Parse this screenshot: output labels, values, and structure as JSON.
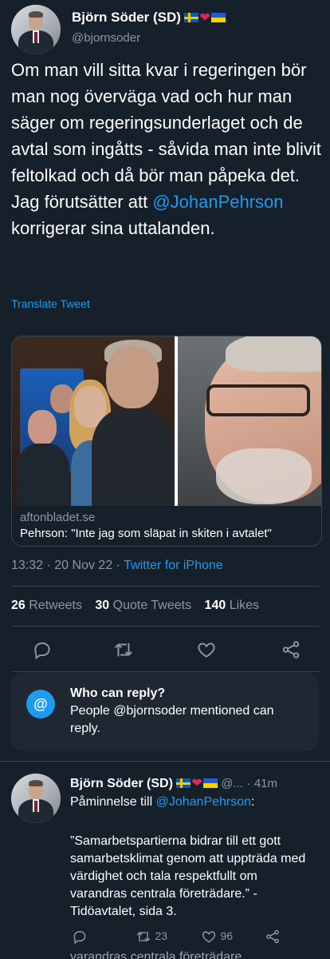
{
  "author": {
    "name": "Björn Söder (SD)",
    "handle": "@bjornsoder",
    "flag_se": "swedish-flag",
    "heart": "❤",
    "flag_ua": "ukrainian-flag"
  },
  "tweet": {
    "text_before": "Om man vill sitta kvar i regeringen bör man nog överväga vad och hur man säger om regeringsunderlaget och de avtal som ingåtts - såvida man inte blivit feltolkad och då bör man påpeka det. Jag förutsätter att ",
    "mention": "@JohanPehrson",
    "text_after": " korrigerar sina uttalanden.",
    "translate": "Translate Tweet"
  },
  "card": {
    "domain": "aftonbladet.se",
    "title": "Pehrson: \"Inte jag som släpat in skiten i avtalet\""
  },
  "meta": {
    "time": "13:32",
    "sep": "·",
    "date": "20 Nov 22",
    "source": "Twitter for iPhone"
  },
  "stats": {
    "retweets_count": "26",
    "retweets_label": "Retweets",
    "quotes_count": "30",
    "quotes_label": "Quote Tweets",
    "likes_count": "140",
    "likes_label": "Likes"
  },
  "actions": {
    "reply_icon": "reply-icon",
    "retweet_icon": "retweet-icon",
    "like_icon": "heart-icon",
    "share_icon": "share-icon"
  },
  "who_can_reply": {
    "icon": "@",
    "title": "Who can reply?",
    "body": "People @bjornsoder mentioned can reply."
  },
  "reply": {
    "name": "Björn Söder (SD)",
    "handle": "@...",
    "sep": "·",
    "time": "41m",
    "prefix": "Påminnelse till ",
    "mention": "@JohanPehrson",
    "suffix": ":",
    "quote": "”Samarbetspartierna bidrar till ett gott samarbetsklimat genom att uppträda med värdighet och tala respektfullt om varandras centrala företrädare.” - Tidöavtalet, sida 3.",
    "retweets": "23",
    "likes": "96",
    "overflow_text": "varandras centrala företrädare."
  },
  "colors": {
    "background": "#15202b",
    "accent": "#1d9bf0",
    "muted": "#8b98a5"
  }
}
